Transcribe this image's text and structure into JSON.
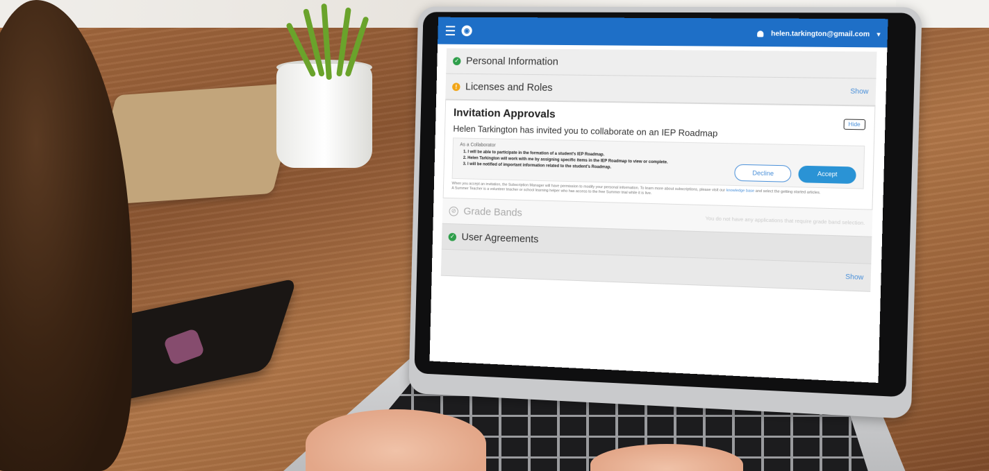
{
  "app": {
    "user_email": "helen.tarkington@gmail.com",
    "logo_icon": "globe-logo-icon",
    "accent_color": "#1e6fc7"
  },
  "sections": {
    "personal_information": {
      "label": "Personal Information",
      "status": "complete"
    },
    "licenses_and_roles": {
      "label": "Licenses and Roles",
      "status": "pending",
      "show_label": "Show"
    },
    "grade_bands": {
      "label": "Grade Bands",
      "status": "not-applicable",
      "note": "You do not have any applications that require grade band selection."
    },
    "user_agreements": {
      "label": "User Agreements",
      "status": "complete",
      "show_label": "Show"
    }
  },
  "invitation": {
    "title": "Invitation Approvals",
    "hide_label": "Hide",
    "message": "Helen Tarkington has invited you to collaborate on an IEP Roadmap",
    "role_title": "As a Collaborator",
    "points": [
      "I will be able to participate in the formation of a student's IEP Roadmap.",
      "Helen Tarkington will work with me by assigning specific items in the IEP Roadmap to view or complete.",
      "I will be notified of important information related to the student's Roadmap."
    ],
    "decline_label": "Decline",
    "accept_label": "Accept",
    "fine_print_1": "When you accept an invitation, the Subscription Manager will have permission to modify your personal information. To learn more about subscriptions, please visit our",
    "fine_print_link": "knowledge base",
    "fine_print_2": "and select the getting started articles.",
    "fine_print_3": "A Summer Teacher is a volunteer teacher or school learning helper who has access to the free Summer trial while it is live."
  }
}
